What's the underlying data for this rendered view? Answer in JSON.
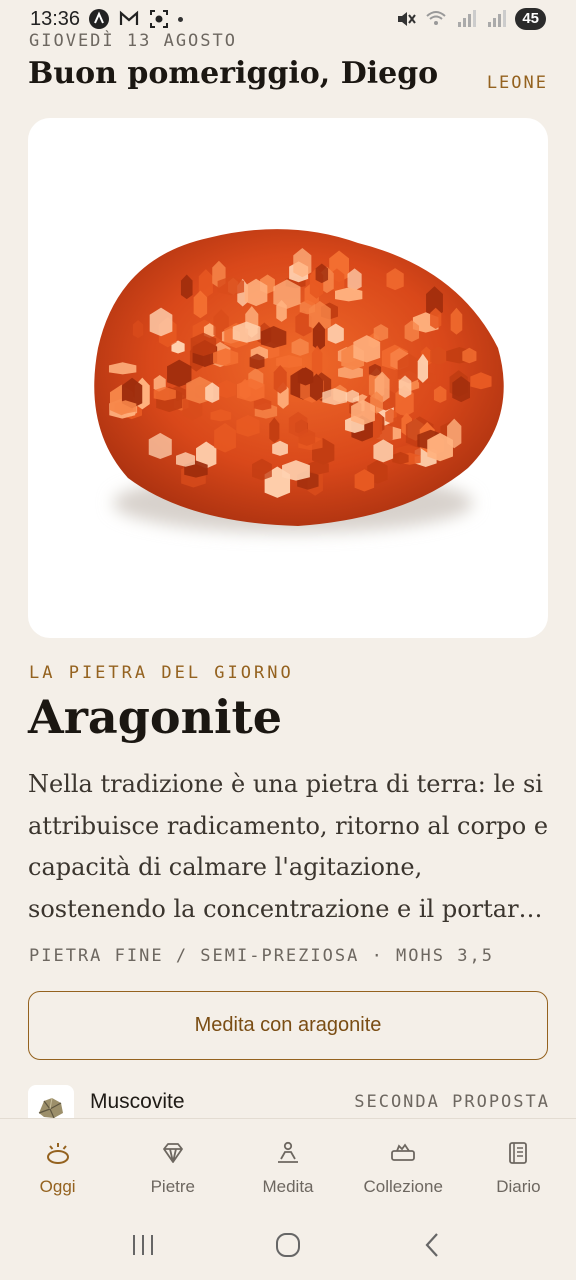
{
  "status_bar": {
    "time": "13:36",
    "battery": "45",
    "icons": [
      "a-circle-icon",
      "gmail-icon",
      "screenshot-icon",
      "mute-icon",
      "wifi-icon",
      "signal-icon",
      "signal-icon"
    ]
  },
  "header": {
    "date": "GIOVEDÌ 13 AGOSTO",
    "greeting": "Buon pomeriggio, Diego",
    "zodiac_sign": "LEONE"
  },
  "stone_of_day": {
    "eyebrow": "LA PIETRA DEL GIORNO",
    "name": "Aragonite",
    "description": "Nella tradizione è una pietra di terra: le si attribuisce radicamento, ritorno al corpo e capacità di calmare l'agitazione, sostenendo la concentrazione e il portar…",
    "meta": "PIETRA FINE / SEMI-PREZIOSA · MOHS 3,5",
    "cta_label": "Medita con aragonite",
    "image": "aragonite-crystal-cluster"
  },
  "second_suggestion": {
    "name": "Muscovite",
    "label": "SECONDA PROPOSTA",
    "image": "muscovite-thumbnail"
  },
  "bottom_nav": {
    "items": [
      {
        "label": "Oggi",
        "icon": "sun-icon",
        "active": true
      },
      {
        "label": "Pietre",
        "icon": "gem-icon",
        "active": false
      },
      {
        "label": "Medita",
        "icon": "meditate-icon",
        "active": false
      },
      {
        "label": "Collezione",
        "icon": "collection-icon",
        "active": false
      },
      {
        "label": "Diario",
        "icon": "journal-icon",
        "active": false
      }
    ]
  },
  "colors": {
    "background": "#f4efe8",
    "accent": "#94621f",
    "text": "#1b1712",
    "muted": "#6d6760"
  }
}
